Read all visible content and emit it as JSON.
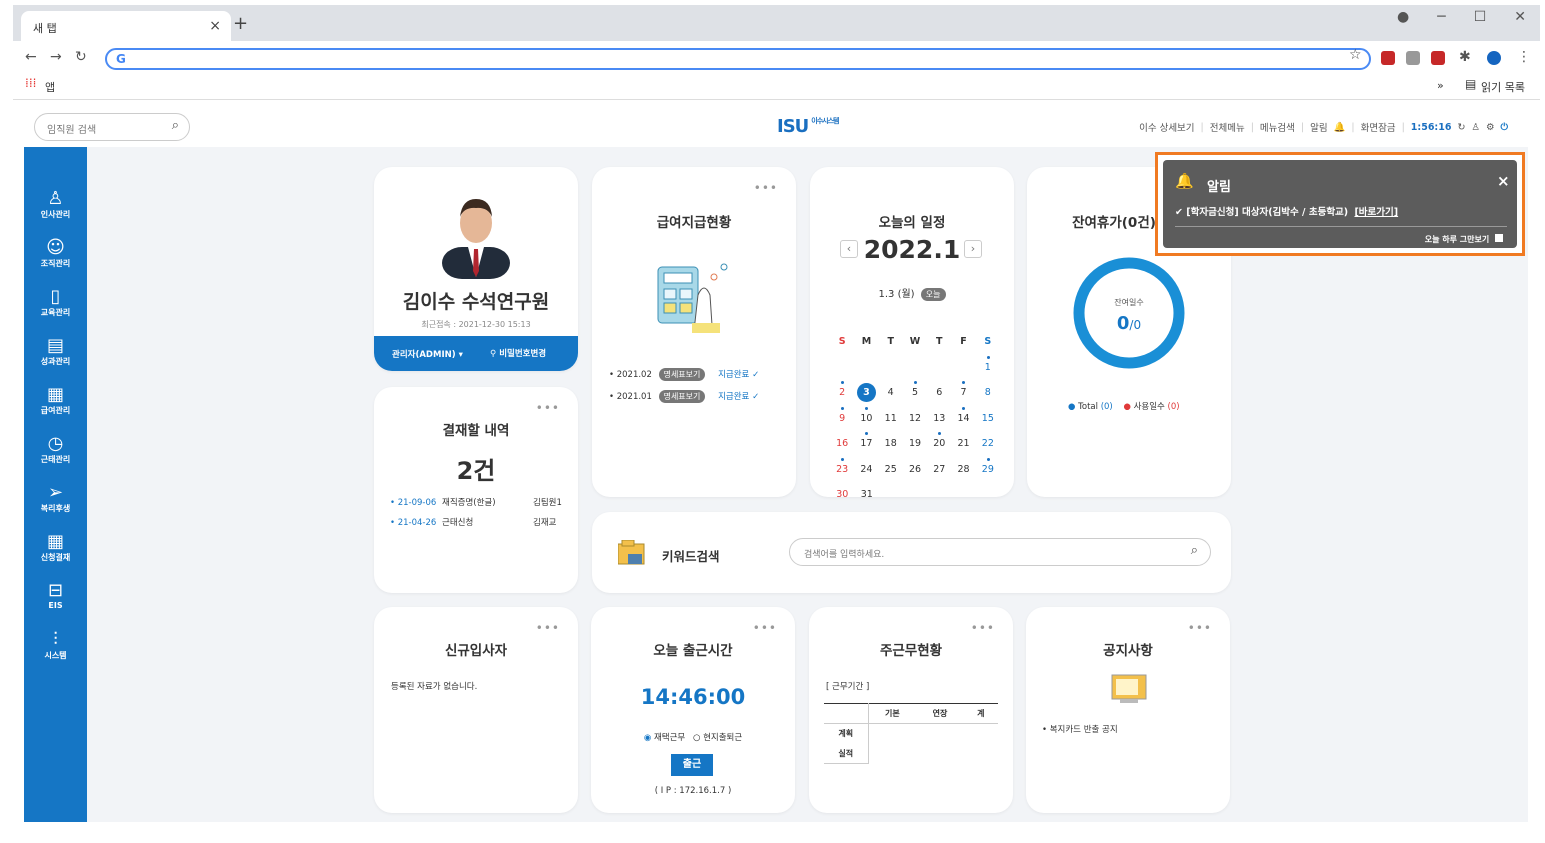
{
  "browser": {
    "tab_title": "새 탭",
    "tab_close": "×",
    "new_tab": "+",
    "address_icon": "G",
    "apps_label": "앱",
    "reading_list": "읽기 목록",
    "more": "»"
  },
  "header": {
    "search_placeholder": "임직원 검색",
    "logo_text": "ISU",
    "logo_sub": "이수시스템",
    "menu": {
      "detail": "이수 상세보기",
      "all_menu": "전체메뉴",
      "menu_search": "메뉴검색",
      "alarm": "알림",
      "screen_lock": "화면잠금",
      "clock": "1:56:16"
    }
  },
  "sidebar": {
    "items": [
      {
        "label": "인사관리",
        "icon": "person-list-icon"
      },
      {
        "label": "조직관리",
        "icon": "chat-icon"
      },
      {
        "label": "교육관리",
        "icon": "book-icon"
      },
      {
        "label": "성과관리",
        "icon": "clipboard-icon"
      },
      {
        "label": "급여관리",
        "icon": "calculator-icon"
      },
      {
        "label": "근태관리",
        "icon": "clock-icon"
      },
      {
        "label": "복리후생",
        "icon": "send-icon"
      },
      {
        "label": "신청결재",
        "icon": "calendar-icon"
      },
      {
        "label": "EIS",
        "icon": "briefcase-icon"
      },
      {
        "label": "시스템",
        "icon": "sliders-icon"
      }
    ]
  },
  "profile": {
    "name": "김이수 수석연구원",
    "last_login": "최근접속 : 2021-12-30 15:13",
    "admin_button": "관리자(ADMIN)",
    "password_button": "비밀번호변경"
  },
  "approval": {
    "title": "결재할 내역",
    "count": "2건",
    "rows": [
      {
        "date": "21-09-06",
        "type": "재직증명(한글)",
        "person": "김팀원1"
      },
      {
        "date": "21-04-26",
        "type": "근태신청",
        "person": "김재교"
      }
    ]
  },
  "payroll": {
    "title": "급여지급현황",
    "rows": [
      {
        "month": "2021.02",
        "detail": "명세표보기",
        "status": "지급완료"
      },
      {
        "month": "2021.01",
        "detail": "명세표보기",
        "status": "지급완료"
      }
    ]
  },
  "schedule": {
    "title": "오늘의 일정",
    "month": "2022.1",
    "today": "1.3 (월)",
    "today_badge": "오늘",
    "weekdays": [
      "S",
      "M",
      "T",
      "W",
      "T",
      "F",
      "S"
    ],
    "weeks": [
      [
        "",
        "",
        "",
        "",
        "",
        "",
        "1"
      ],
      [
        "2",
        "3",
        "4",
        "5",
        "6",
        "7",
        "8"
      ],
      [
        "9",
        "10",
        "11",
        "12",
        "13",
        "14",
        "15"
      ],
      [
        "16",
        "17",
        "18",
        "19",
        "20",
        "21",
        "22"
      ],
      [
        "23",
        "24",
        "25",
        "26",
        "27",
        "28",
        "29"
      ],
      [
        "30",
        "31",
        "",
        "",
        "",
        "",
        ""
      ]
    ]
  },
  "vacation": {
    "title": "잔여휴가(0건)",
    "remaining_label": "잔여일수",
    "remaining_value": "0",
    "total_value": "/0",
    "legend_total": "Total",
    "legend_total_value": "(0)",
    "legend_used": "사용일수",
    "legend_used_value": "(0)"
  },
  "alert": {
    "title": "알림",
    "message": "[학자금신청] 대상자(김박수 / 초등학교)",
    "link": "[바로가기]",
    "dismiss": "오늘 하루 그만보기",
    "close": "×"
  },
  "keyword": {
    "title": "키워드검색",
    "placeholder": "검색어를 입력하세요."
  },
  "new_hires": {
    "title": "신규입사자",
    "empty": "등록된 자료가 없습니다."
  },
  "attendance": {
    "title": "오늘 출근시간",
    "time": "14:46:00",
    "option_home": "재택근무",
    "option_onsite": "현지출퇴근",
    "button": "출근",
    "ip": "( I P : 172.16.1.7 )"
  },
  "weekly": {
    "title": "주근무현황",
    "period": "[ 근무기간 ]",
    "columns": [
      "기본",
      "연장",
      "계"
    ],
    "rows": [
      "계획",
      "실적"
    ]
  },
  "notice": {
    "title": "공지사항",
    "items": [
      "복지카드 반출 공지"
    ]
  },
  "colors": {
    "brand": "#1576c5",
    "alert_border": "#f07a22",
    "weekend_red": "#e03a3a"
  }
}
